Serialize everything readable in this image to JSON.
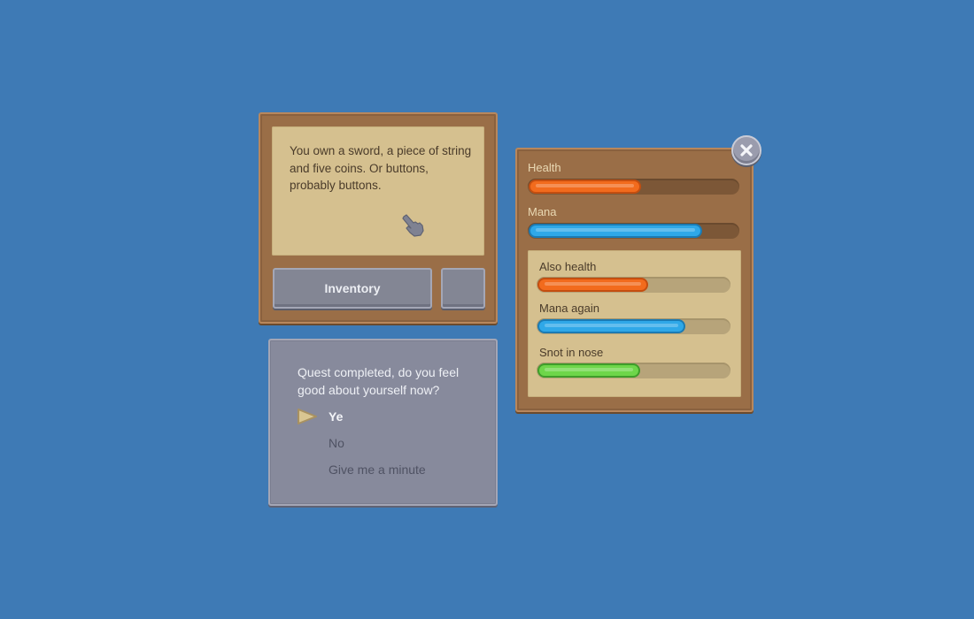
{
  "story_panel": {
    "text": "You own a sword, a piece of string and five coins. Or buttons, probably buttons.",
    "inventory_button": "Inventory",
    "small_button": ""
  },
  "stats_panel": {
    "bars_top": [
      {
        "label": "Health",
        "value": 0.54,
        "color": "#f26b1d",
        "border": "#c44e10"
      },
      {
        "label": "Mana",
        "value": 0.83,
        "color": "#2fa8e8",
        "border": "#1c7bb3"
      }
    ],
    "bars_inner": [
      {
        "label": "Also health",
        "value": 0.58,
        "color": "#f26b1d",
        "border": "#c44e10"
      },
      {
        "label": "Mana again",
        "value": 0.77,
        "color": "#2fa8e8",
        "border": "#1c7bb3"
      },
      {
        "label": "Snot in nose",
        "value": 0.54,
        "color": "#6ed64a",
        "border": "#3f9d2a"
      }
    ]
  },
  "quest_panel": {
    "question": "Quest completed, do you feel good about yourself now?",
    "choices": [
      "Ye",
      "No",
      "Give me a minute"
    ],
    "selected_index": 0
  },
  "colors": {
    "background": "#3e7ab5",
    "brown_panel": "#9a6e47",
    "parchment": "#d5c08f",
    "gray_panel": "#878a9c"
  },
  "icons": {
    "pointer": "hand-pointer-icon",
    "close": "close-icon",
    "selector": "arrow-right-icon"
  }
}
